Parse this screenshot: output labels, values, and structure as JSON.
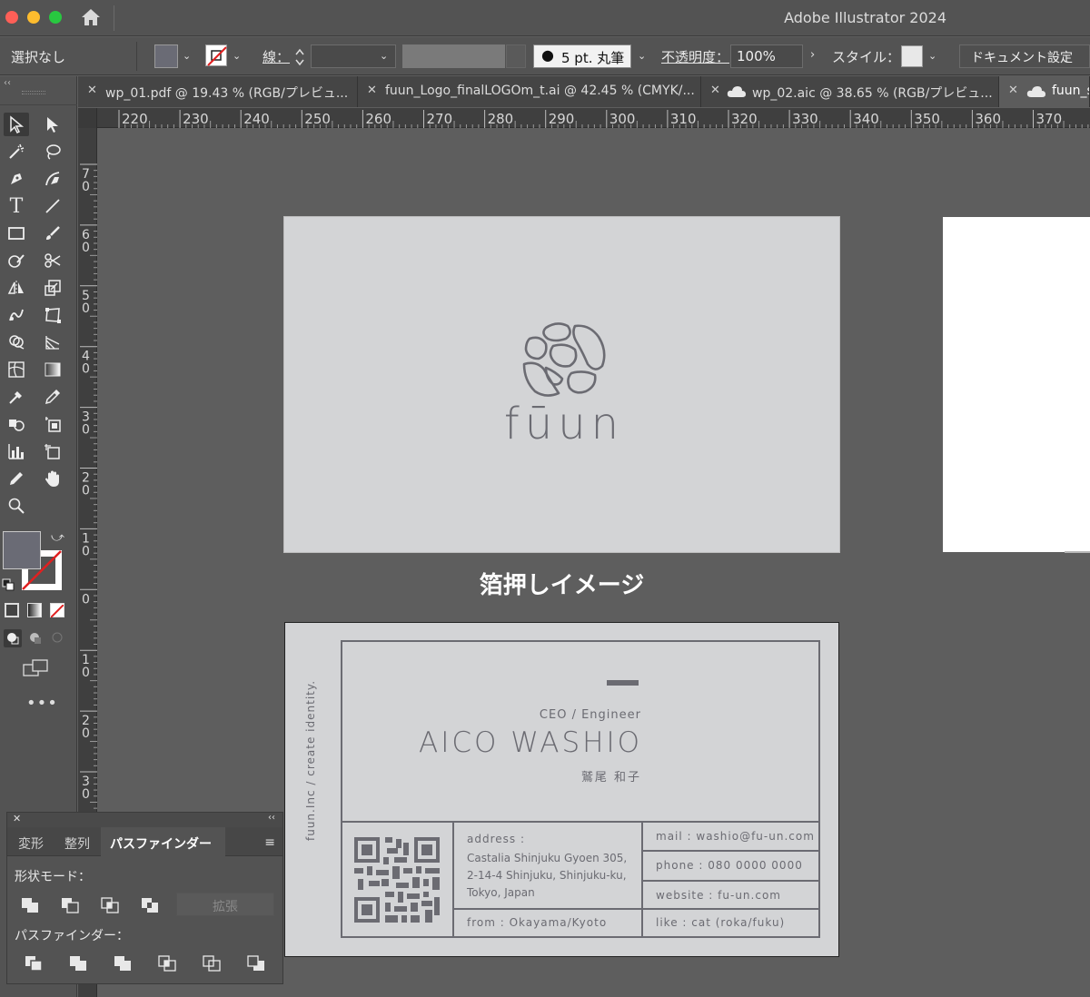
{
  "window": {
    "app_title": "Adobe Illustrator 2024"
  },
  "control_bar": {
    "selection_label": "選択なし",
    "stroke_label": "線：",
    "brush_value": "5 pt. 丸筆",
    "opacity_label": "不透明度：",
    "opacity_value": "100%",
    "style_label": "スタイル：",
    "doc_setup_button": "ドキュメント設定"
  },
  "tabs": [
    {
      "label": "wp_01.pdf @ 19.43 % (RGB/プレビュ...",
      "cloud": false,
      "active": false
    },
    {
      "label": "fuun_Logo_finalLOGOm_t.ai @ 42.45 % (CMYK/...",
      "cloud": false,
      "active": false
    },
    {
      "label": "wp_02.aic @ 38.65 % (RGB/プレビュ...",
      "cloud": true,
      "active": false
    },
    {
      "label": "fuun_s",
      "cloud": true,
      "active": true
    }
  ],
  "rulers": {
    "horizontal": [
      "220",
      "230",
      "240",
      "250",
      "260",
      "270",
      "280",
      "290",
      "300",
      "310",
      "320",
      "330",
      "340",
      "350",
      "360",
      "370"
    ],
    "vertical": [
      "70",
      "60",
      "50",
      "40",
      "30",
      "20",
      "10",
      "0",
      "10",
      "20",
      "30"
    ]
  },
  "canvas": {
    "caption": "箔押しイメージ",
    "front_card": {
      "logo_text": "fūun"
    },
    "back_card": {
      "side_text": "fuun.Inc / create identity.",
      "title": "CEO / Engineer",
      "name": "AICO WASHIO",
      "name_jp": "鷲尾 和子",
      "address_label": "address :",
      "address_lines": [
        "Castalia Shinjuku Gyoen 305,",
        "2-14-4 Shinjuku, Shinjuku-ku,",
        "Tokyo, Japan"
      ],
      "from": "from : Okayama/Kyoto",
      "mail": "mail : washio@fu-un.com",
      "phone": "phone : 080 0000 0000",
      "website": "website : fu-un.com",
      "like": "like : cat (roka/fuku)"
    }
  },
  "pathfinder_panel": {
    "tabs": [
      "変形",
      "整列",
      "パスファインダー"
    ],
    "shape_modes_label": "形状モード：",
    "expand_button": "拡張",
    "pathfinders_label": "パスファインダー："
  },
  "colors": {
    "card_fill": "#d3d4d6",
    "card_ink": "#6b6b72",
    "fill_swatch": "#6a6b75"
  }
}
